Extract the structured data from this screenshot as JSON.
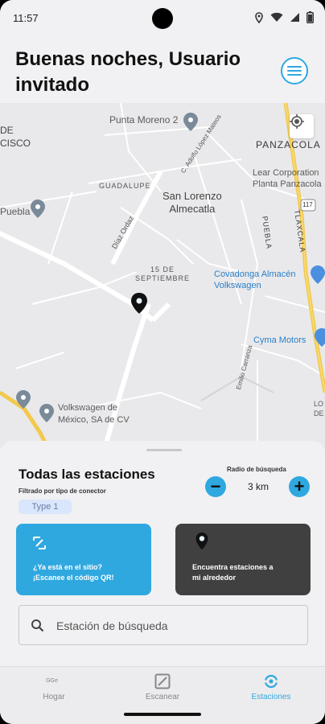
{
  "status_bar": {
    "time": "11:57",
    "icons": [
      "location-icon",
      "wifi-icon",
      "signal-icon",
      "battery-icon"
    ]
  },
  "header": {
    "greeting": "Buenas noches, Usuario invitado",
    "menu_icon": "hamburger-menu-icon"
  },
  "map": {
    "labels": {
      "de_cisco": "DE\nCISCO",
      "punta_moreno": "Punta Moreno 2",
      "panzacola": "PANZACOLA",
      "guadalupe": "GUADALUPE",
      "adolfo": "C. Adolfo López Mateos",
      "san_lorenzo": "San Lorenzo\nAlmecatla",
      "lear": "Lear Corporation\nPlanta Panzacola",
      "puebla_place": "Puebla",
      "tlaxcala": "TLAXCALA",
      "puebla_road": "PUEBLA",
      "diaz_ordaz": "Díaz Ordaz",
      "sept15": "15 DE\nSEPTIEMBRE",
      "covadonga": "Covadonga Almacén\nVolkswagen",
      "cyma": "Cyma Motors",
      "emilio": "Emilio Carranza",
      "vw_mexico": "Volkswagen de\nMéxico, SA de CV",
      "lo": "LO\nDE",
      "road_117": "117"
    }
  },
  "sheet": {
    "title": "Todas las estaciones",
    "filter_caption": "Filtrado por tipo de conector",
    "connector_chip": "Type 1",
    "radius_caption": "Radio de búsqueda",
    "radius_value": "3 km",
    "minus_label": "−",
    "plus_label": "+",
    "qr_card_text": "¿Ya está en el sitio?\n¡Escanee el código QR!",
    "near_card_text": "Encuentra estaciones a\nmi alrededor",
    "search_placeholder": "Estación de búsqueda"
  },
  "nav": {
    "items": [
      {
        "label": "Hogar",
        "icon": "home-icon"
      },
      {
        "label": "Escanear",
        "icon": "scan-icon"
      },
      {
        "label": "Estaciones",
        "icon": "stations-icon"
      }
    ],
    "active": "Estaciones"
  },
  "colors": {
    "accent": "#2fa8e0",
    "dark_card": "#404040",
    "chip_bg": "#d9e6fb"
  }
}
